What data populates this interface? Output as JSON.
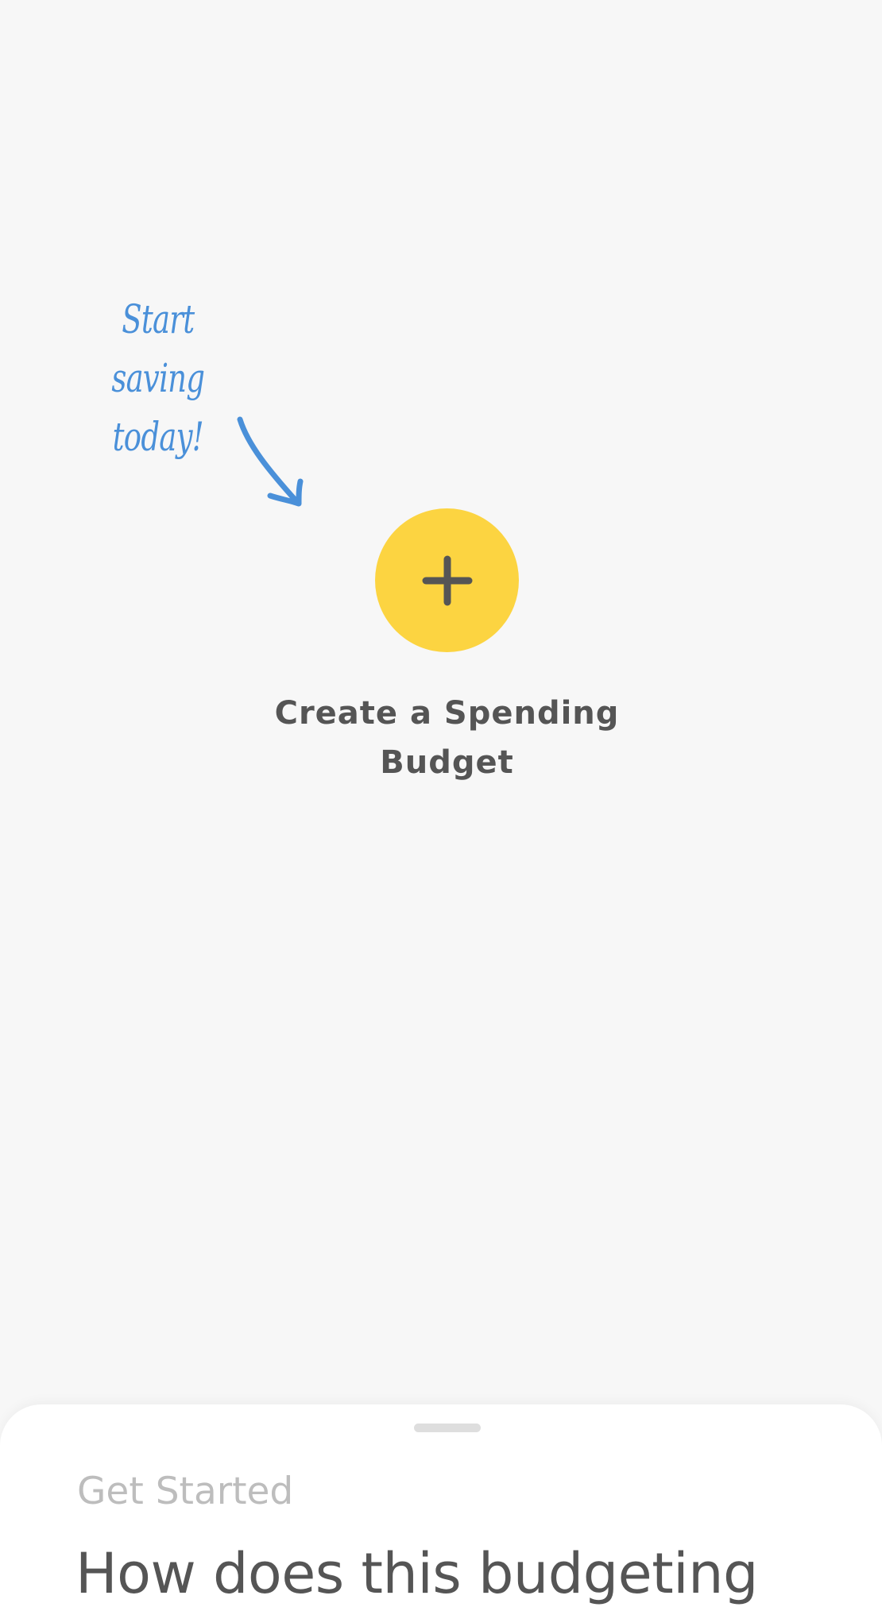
{
  "annotation": {
    "line1": "Start saving",
    "line2": "today!",
    "color": "#4a90d9"
  },
  "arrow": {
    "icon": "hand-drawn-arrow-icon"
  },
  "add_button": {
    "icon": "plus-icon",
    "color": "#fcd441"
  },
  "create_budget": {
    "line1": "Create a Spending",
    "line2": "Budget"
  },
  "bottom_sheet": {
    "eyebrow": "Get Started",
    "title": "How does this budgeting"
  }
}
